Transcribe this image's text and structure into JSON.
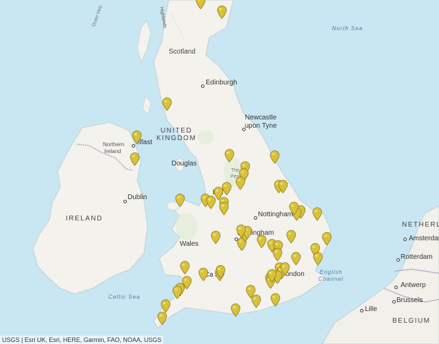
{
  "map": {
    "labels": {
      "scotland": "Scotland",
      "edinburgh": "Edinburgh",
      "newcastle_line1": "Newcastle",
      "newcastle_line2": "upon Tyne",
      "united": "UNITED",
      "kingdom": "KINGDOM",
      "northern_ireland_line1": "Northern",
      "northern_ireland_line2": "Ireland",
      "belfast": "elfast",
      "douglas": "Douglas",
      "dublin": "Dublin",
      "ireland": "IRELAND",
      "nottingham": "Nottingham",
      "birmingham": "Birmingham",
      "wales": "Wales",
      "cardiff": "Ca   ff",
      "london": "ondon",
      "liverpool": "L      ol",
      "pennines_1": "The",
      "pennines_2": "Penni",
      "highlands": "Highlands",
      "outer_hebrides": "Outer Heb",
      "north_sea": "North Sea",
      "celtic_sea": "Celtic Sea",
      "english_channel_1": "English",
      "english_channel_2": "Channel",
      "netherlands": "NETHERL",
      "amsterdam": "Amsterdam",
      "rotterdam": "Rotterdam",
      "antwerp": "Antwerp",
      "brussels": "Brussels",
      "lille": "Lille",
      "belgium": "BELGIUM"
    },
    "attribution": "USGS | Esri UK, Esri, HERE, Garmin, FAO, NOAA, USGS",
    "pin_color": "#d9c13a",
    "pin_count": 57
  }
}
